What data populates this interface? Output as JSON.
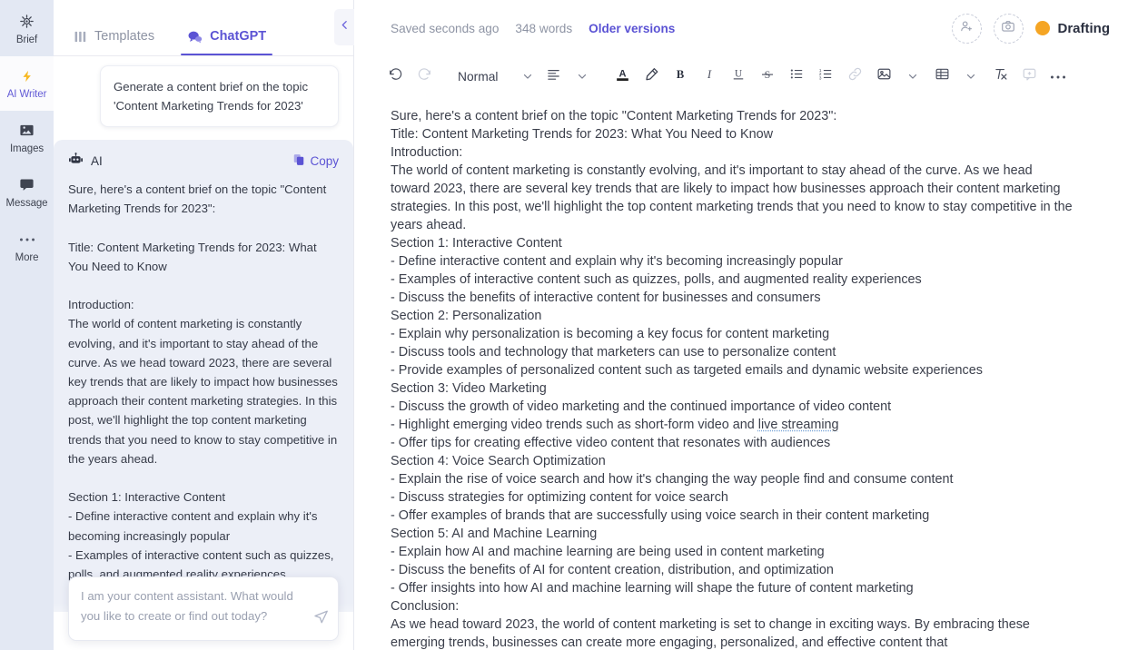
{
  "rail": {
    "items": [
      {
        "label": "Brief",
        "icon": "target-icon",
        "active": false
      },
      {
        "label": "AI Writer",
        "icon": "bolt-icon",
        "active": true
      },
      {
        "label": "Images",
        "icon": "image-icon",
        "active": false
      },
      {
        "label": "Message",
        "icon": "message-icon",
        "active": false
      },
      {
        "label": "More",
        "icon": "ellipsis-icon",
        "active": false
      }
    ]
  },
  "chat": {
    "tabs": [
      {
        "label": "Templates",
        "icon": "templates-icon",
        "active": false
      },
      {
        "label": "ChatGPT",
        "icon": "chat-bubbles-icon",
        "active": true
      }
    ],
    "collapse_icon": "chevron-left-icon",
    "user_message": "Generate a content brief on the topic 'Content Marketing Trends for 2023'",
    "ai_label": "AI",
    "ai_avatar_icon": "robot-icon",
    "copy_label": "Copy",
    "copy_icon": "copy-icon",
    "ai_message": "Sure, here's a content brief on the topic \"Content Marketing Trends for 2023\":\n\nTitle: Content Marketing Trends for 2023: What You Need to Know\n\nIntroduction:\nThe world of content marketing is constantly evolving, and it's important to stay ahead of the curve. As we head toward 2023, there are several key trends that are likely to impact how businesses approach their content marketing strategies. In this post, we'll highlight the top content marketing trends that you need to know to stay competitive in the years ahead.\n\nSection 1: Interactive Content\n- Define interactive content and explain why it's becoming increasingly popular\n- Examples of interactive content such as quizzes, polls, and augmented reality experiences",
    "composer_placeholder": "I am your content assistant. What would you like to create or find out today?",
    "composer_value": "",
    "send_icon": "send-icon"
  },
  "editor": {
    "saved_text": "Saved seconds ago",
    "word_count": "348 words",
    "older_versions": "Older versions",
    "invite_icon": "add-user-icon",
    "snapshot_icon": "camera-icon",
    "status_label": "Drafting",
    "status_color": "#f5a524",
    "toolbar": {
      "undo": "undo-icon",
      "redo": "redo-icon",
      "style_value": "Normal",
      "align": "align-left-icon",
      "text_color": "text-color-icon",
      "text_color_swatch": "#1d1d1d",
      "highlight": "highlighter-icon",
      "bold": "B",
      "italic": "I",
      "underline": "U",
      "strikethrough": "S",
      "bullet_list": "bullet-list-icon",
      "numbered_list": "numbered-list-icon",
      "link": "link-icon",
      "image": "image-icon",
      "table": "table-icon",
      "clear_format": "clear-format-icon",
      "comment": "comment-icon",
      "more": "ellipsis-icon"
    },
    "document": {
      "lines": [
        "Sure, here's a content brief on the topic \"Content Marketing Trends for 2023\":",
        "Title: Content Marketing Trends for 2023: What You Need to Know",
        "Introduction:",
        "The world of content marketing is constantly evolving, and it's important to stay ahead of the curve. As we head toward 2023, there are several key trends that are likely to impact how businesses approach their content marketing strategies. In this post, we'll highlight the top content marketing trends that you need to know to stay competitive in the years ahead.",
        "Section 1: Interactive Content",
        "- Define interactive content and explain why it's becoming increasingly popular",
        "- Examples of interactive content such as quizzes, polls, and augmented reality experiences",
        "- Discuss the benefits of interactive content for businesses and consumers",
        "Section 2: Personalization",
        "- Explain why personalization is becoming a key focus for content marketing",
        "- Discuss tools and technology that marketers can use to personalize content",
        "- Provide examples of personalized content such as targeted emails and dynamic website experiences",
        "Section 3: Video Marketing",
        "- Discuss the growth of video marketing and the continued importance of video content",
        "- Highlight emerging video trends such as short-form video and live streaming",
        "- Offer tips for creating effective video content that resonates with audiences",
        "Section 4: Voice Search Optimization",
        "- Explain the rise of voice search and how it's changing the way people find and consume content",
        "- Discuss strategies for optimizing content for voice search",
        "- Offer examples of brands that are successfully using voice search in their content marketing",
        "Section 5: AI and Machine Learning",
        "- Explain how AI and machine learning are being used in content marketing",
        "- Discuss the benefits of AI for content creation, distribution, and optimization",
        "- Offer insights into how AI and machine learning will shape the future of content marketing",
        "Conclusion:",
        "As we head toward 2023, the world of content marketing is set to change in exciting ways. By embracing these emerging trends, businesses can create more engaging, personalized, and effective content that"
      ],
      "spellcheck_phrase": "live streaming"
    }
  }
}
